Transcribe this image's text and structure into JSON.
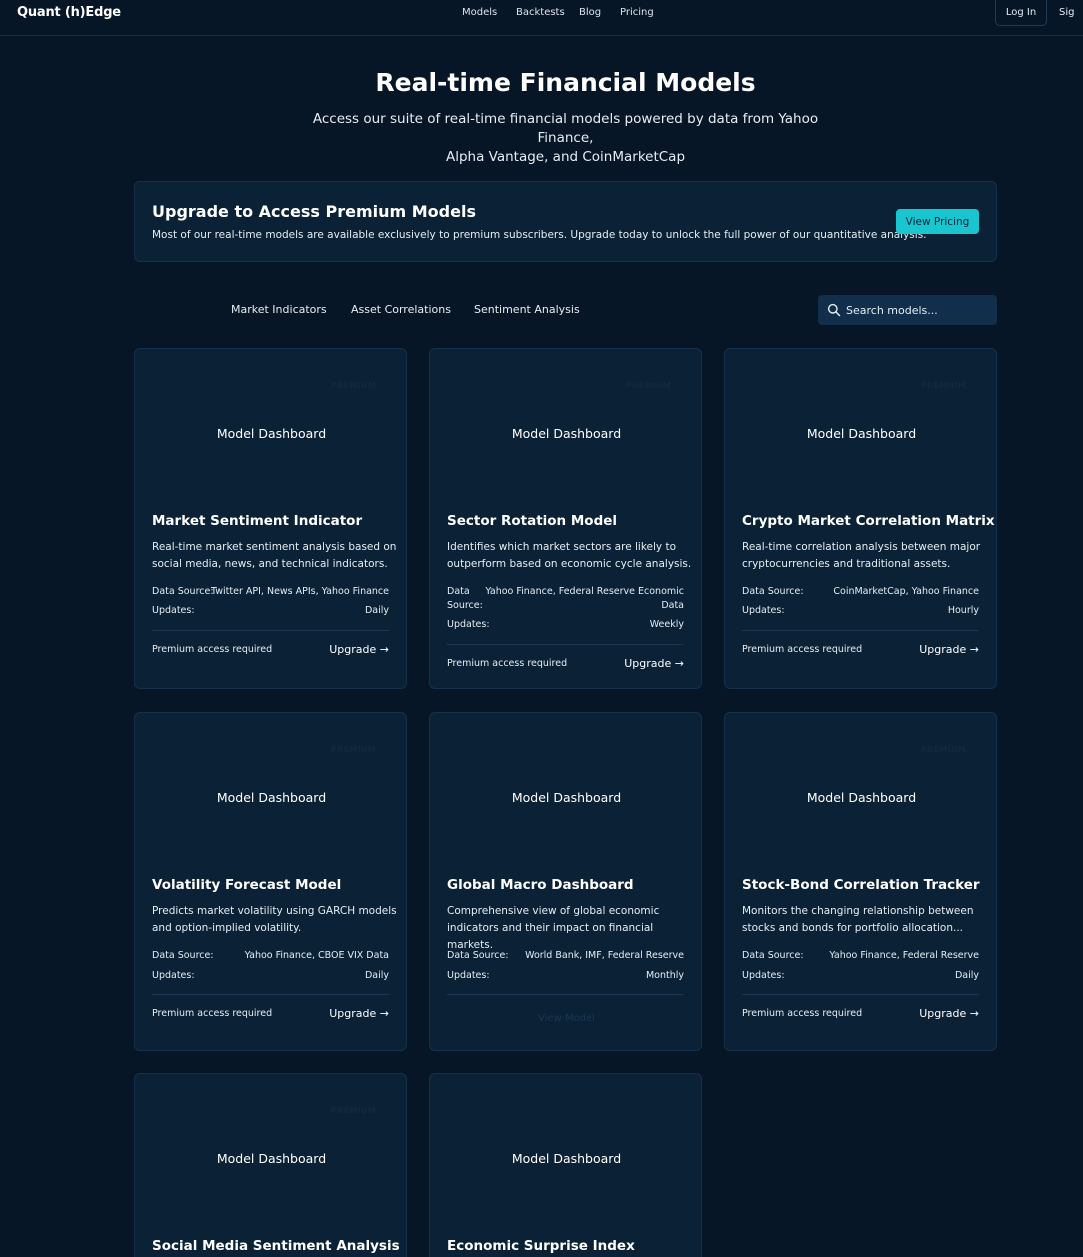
{
  "nav": {
    "logo": "Quant (h)Edge",
    "links": [
      "Models",
      "Backtests",
      "Blog",
      "Pricing"
    ],
    "login": "Log In",
    "signup": "Sig"
  },
  "hero": {
    "title": "Real-time Financial Models",
    "subtitle_line1": "Access our suite of real-time financial models powered by data from Yahoo Finance,",
    "subtitle_line2": "Alpha Vantage, and CoinMarketCap"
  },
  "banner": {
    "title": "Upgrade to Access Premium Models",
    "text": "Most of our real-time models are available exclusively to premium subscribers. Upgrade today to unlock the full power of our quantitative analysis.",
    "button": "View Pricing"
  },
  "filters": {
    "tabs": [
      "Market Indicators",
      "Asset Correlations",
      "Sentiment Analysis"
    ],
    "search_placeholder": "Search models..."
  },
  "common": {
    "preview_label": "Model Dashboard",
    "premium_tag": "PREMIUM",
    "data_source_label": "Data Source:",
    "data_label": "Data",
    "source_label": "Source:",
    "updates_label": "Updates:",
    "access_text": "Premium access required",
    "upgrade_text": "Upgrade →",
    "view_model": "View Model"
  },
  "cards": [
    {
      "title": "Market Sentiment Indicator",
      "desc": "Real-time market sentiment analysis based on social media, news, and technical indicators.",
      "source": "Twitter API, News APIs, Yahoo Finance",
      "updates": "Daily",
      "premium": true
    },
    {
      "title": "Sector Rotation Model",
      "desc": "Identifies which market sectors are likely to outperform based on economic cycle analysis.",
      "source_line1": "Yahoo Finance, Federal Reserve Economic",
      "source_line2": "Data",
      "updates": "Weekly",
      "premium": true
    },
    {
      "title": "Crypto Market Correlation Matrix",
      "desc": "Real-time correlation analysis between major cryptocurrencies and traditional assets.",
      "source": "CoinMarketCap, Yahoo Finance",
      "updates": "Hourly",
      "premium": true
    },
    {
      "title": "Volatility Forecast Model",
      "desc": "Predicts market volatility using GARCH models and option-implied volatility.",
      "source": "Yahoo Finance, CBOE VIX Data",
      "updates": "Daily",
      "premium": true
    },
    {
      "title": "Global Macro Dashboard",
      "desc": "Comprehensive view of global economic indicators and their impact on financial markets.",
      "source": "World Bank, IMF, Federal Reserve",
      "updates": "Monthly",
      "premium": false
    },
    {
      "title": "Stock-Bond Correlation Tracker",
      "desc": "Monitors the changing relationship between stocks and bonds for portfolio allocation...",
      "source": "Yahoo Finance, Federal Reserve",
      "updates": "Daily",
      "premium": true
    },
    {
      "title": "Social Media Sentiment Analysis",
      "premium": true
    },
    {
      "title": "Economic Surprise Index",
      "premium": false
    }
  ]
}
